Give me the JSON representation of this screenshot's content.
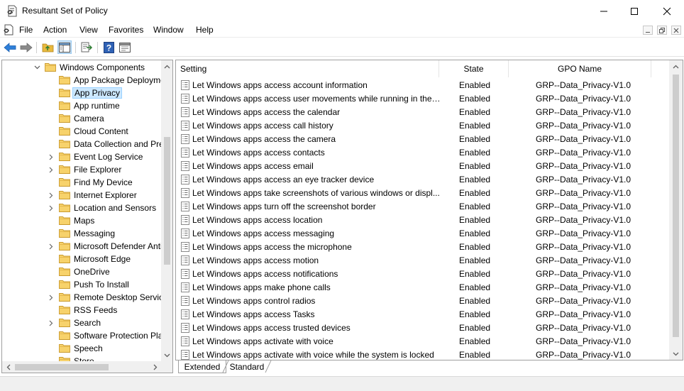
{
  "window": {
    "title": "Resultant Set of Policy"
  },
  "menu": {
    "items": [
      "File",
      "Action",
      "View",
      "Favorites",
      "Window",
      "Help"
    ]
  },
  "tree": {
    "items": [
      {
        "label": "Windows Components",
        "expanded": true
      },
      {
        "label": "App Package Deployment"
      },
      {
        "label": "App Privacy",
        "selected": true
      },
      {
        "label": "App runtime"
      },
      {
        "label": "Camera"
      },
      {
        "label": "Cloud Content"
      },
      {
        "label": "Data Collection and Preview Builds"
      },
      {
        "label": "Event Log Service",
        "expandable": true
      },
      {
        "label": "File Explorer",
        "expandable": true
      },
      {
        "label": "Find My Device"
      },
      {
        "label": "Internet Explorer",
        "expandable": true
      },
      {
        "label": "Location and Sensors",
        "expandable": true
      },
      {
        "label": "Maps"
      },
      {
        "label": "Messaging"
      },
      {
        "label": "Microsoft Defender Antivirus",
        "expandable": true
      },
      {
        "label": "Microsoft Edge"
      },
      {
        "label": "OneDrive"
      },
      {
        "label": "Push To Install"
      },
      {
        "label": "Remote Desktop Services",
        "expandable": true
      },
      {
        "label": "RSS Feeds"
      },
      {
        "label": "Search",
        "expandable": true
      },
      {
        "label": "Software Protection Platform"
      },
      {
        "label": "Speech"
      },
      {
        "label": "Store"
      }
    ]
  },
  "list": {
    "columns": [
      "Setting",
      "State",
      "GPO Name"
    ],
    "rows": [
      {
        "setting": "Let Windows apps access account information",
        "state": "Enabled",
        "gpo": "GRP--Data_Privacy-V1.0"
      },
      {
        "setting": "Let Windows apps access user movements while running in the ...",
        "state": "Enabled",
        "gpo": "GRP--Data_Privacy-V1.0"
      },
      {
        "setting": "Let Windows apps access the calendar",
        "state": "Enabled",
        "gpo": "GRP--Data_Privacy-V1.0"
      },
      {
        "setting": "Let Windows apps access call history",
        "state": "Enabled",
        "gpo": "GRP--Data_Privacy-V1.0"
      },
      {
        "setting": "Let Windows apps access the camera",
        "state": "Enabled",
        "gpo": "GRP--Data_Privacy-V1.0"
      },
      {
        "setting": "Let Windows apps access contacts",
        "state": "Enabled",
        "gpo": "GRP--Data_Privacy-V1.0"
      },
      {
        "setting": "Let Windows apps access email",
        "state": "Enabled",
        "gpo": "GRP--Data_Privacy-V1.0"
      },
      {
        "setting": "Let Windows apps access an eye tracker device",
        "state": "Enabled",
        "gpo": "GRP--Data_Privacy-V1.0"
      },
      {
        "setting": "Let Windows apps take screenshots of various windows or displ...",
        "state": "Enabled",
        "gpo": "GRP--Data_Privacy-V1.0"
      },
      {
        "setting": "Let Windows apps turn off the screenshot border",
        "state": "Enabled",
        "gpo": "GRP--Data_Privacy-V1.0"
      },
      {
        "setting": "Let Windows apps access location",
        "state": "Enabled",
        "gpo": "GRP--Data_Privacy-V1.0"
      },
      {
        "setting": "Let Windows apps access messaging",
        "state": "Enabled",
        "gpo": "GRP--Data_Privacy-V1.0"
      },
      {
        "setting": "Let Windows apps access the microphone",
        "state": "Enabled",
        "gpo": "GRP--Data_Privacy-V1.0"
      },
      {
        "setting": "Let Windows apps access motion",
        "state": "Enabled",
        "gpo": "GRP--Data_Privacy-V1.0"
      },
      {
        "setting": "Let Windows apps access notifications",
        "state": "Enabled",
        "gpo": "GRP--Data_Privacy-V1.0"
      },
      {
        "setting": "Let Windows apps make phone calls",
        "state": "Enabled",
        "gpo": "GRP--Data_Privacy-V1.0"
      },
      {
        "setting": "Let Windows apps control radios",
        "state": "Enabled",
        "gpo": "GRP--Data_Privacy-V1.0"
      },
      {
        "setting": "Let Windows apps access Tasks",
        "state": "Enabled",
        "gpo": "GRP--Data_Privacy-V1.0"
      },
      {
        "setting": "Let Windows apps access trusted devices",
        "state": "Enabled",
        "gpo": "GRP--Data_Privacy-V1.0"
      },
      {
        "setting": "Let Windows apps activate with voice",
        "state": "Enabled",
        "gpo": "GRP--Data_Privacy-V1.0"
      },
      {
        "setting": "Let Windows apps activate with voice while the system is locked",
        "state": "Enabled",
        "gpo": "GRP--Data_Privacy-V1.0"
      }
    ]
  },
  "tabs": [
    "Extended",
    "Standard"
  ],
  "colors": {
    "accent_blue": "#1e6fd6",
    "folder_yellow": "#f5c544",
    "selection": "#cce8ff"
  },
  "icons": {
    "window": [
      "minimize-icon",
      "maximize-icon",
      "close-icon"
    ],
    "toolbar": [
      "back-arrow-icon",
      "forward-arrow-icon",
      "up-folder-icon",
      "show-hide-tree-icon",
      "export-list-icon",
      "help-icon",
      "properties-icon"
    ]
  }
}
